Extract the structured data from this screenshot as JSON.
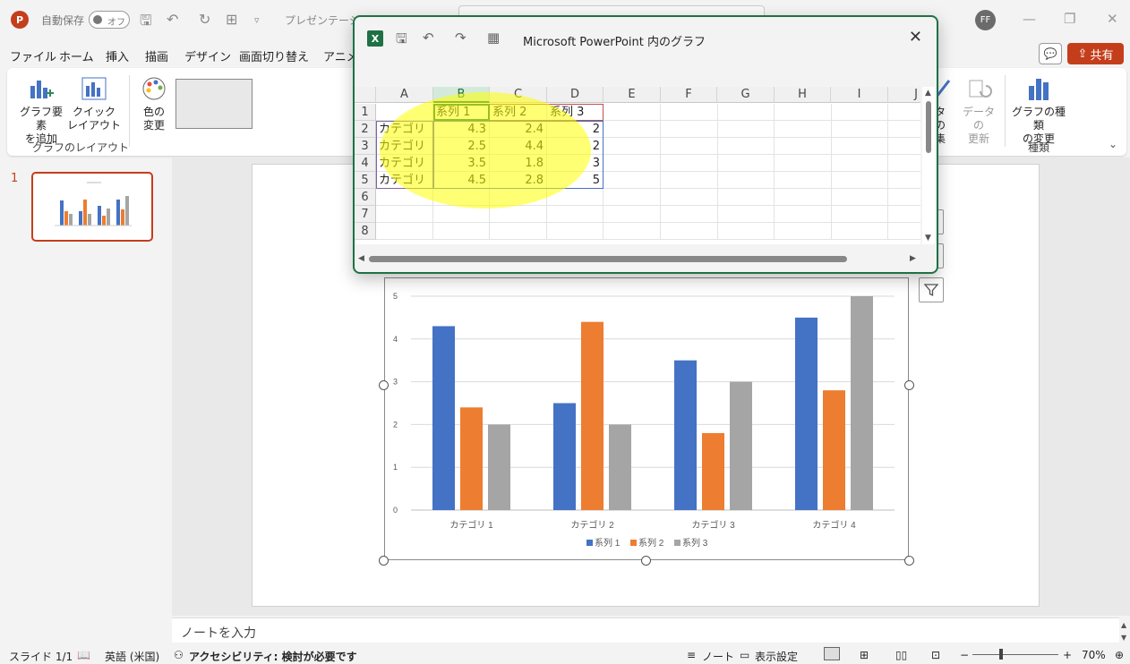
{
  "titlebar": {
    "autosave_label": "自動保存",
    "toggle_text": "オフ",
    "doc_title": "プレゼンテーション",
    "avatar_initials": "FF"
  },
  "menu": {
    "items": [
      "ファイル",
      "ホーム",
      "挿入",
      "描画",
      "デザイン",
      "画面切り替え",
      "アニメ"
    ],
    "share_label": "共有"
  },
  "ribbon": {
    "add_element": "グラフ要素\nを追加",
    "quick_layout": "クイック\nレイアウト",
    "change_color": "色の\n変更",
    "layout_group": "グラフのレイアウト",
    "data_partial": "タの\n集",
    "refresh_data": "データの\n更新",
    "change_type": "グラフの種類\nの変更",
    "type_group": "種類"
  },
  "slides": {
    "current_number": "1"
  },
  "excel_dialog": {
    "title": "Microsoft PowerPoint 内のグラフ",
    "columns": [
      "A",
      "B",
      "C",
      "D",
      "E",
      "F",
      "G",
      "H",
      "I",
      "J"
    ],
    "rows": [
      "1",
      "2",
      "3",
      "4",
      "5",
      "6",
      "7",
      "8"
    ],
    "cells": [
      [
        "",
        "系列 1",
        "系列 2",
        "系列 3"
      ],
      [
        "カテゴリ",
        "4.3",
        "2.4",
        "2"
      ],
      [
        "カテゴリ",
        "2.5",
        "4.4",
        "2"
      ],
      [
        "カテゴリ",
        "3.5",
        "1.8",
        "3"
      ],
      [
        "カテゴリ",
        "4.5",
        "2.8",
        "5"
      ]
    ]
  },
  "chart_data": {
    "type": "bar",
    "categories": [
      "カテゴリ 1",
      "カテゴリ 2",
      "カテゴリ 3",
      "カテゴリ 4"
    ],
    "series": [
      {
        "name": "系列 1",
        "values": [
          4.3,
          2.5,
          3.5,
          4.5
        ],
        "color": "#4472c4"
      },
      {
        "name": "系列 2",
        "values": [
          2.4,
          4.4,
          1.8,
          2.8
        ],
        "color": "#ed7d31"
      },
      {
        "name": "系列 3",
        "values": [
          2,
          2,
          3,
          5
        ],
        "color": "#a5a5a5"
      }
    ],
    "ylim": [
      0,
      5
    ],
    "yticks": [
      "0",
      "1",
      "2",
      "3",
      "4",
      "5"
    ],
    "grid": true,
    "legend": "bottom"
  },
  "notes_placeholder": "ノートを入力",
  "status": {
    "slide": "スライド 1/1",
    "language": "英語 (米国)",
    "accessibility": "アクセシビリティ: 検討が必要です",
    "notes": "ノート",
    "display": "表示設定",
    "zoom": "70%"
  },
  "colors": {
    "accent": "#c43e1c",
    "excel": "#1e7145"
  }
}
